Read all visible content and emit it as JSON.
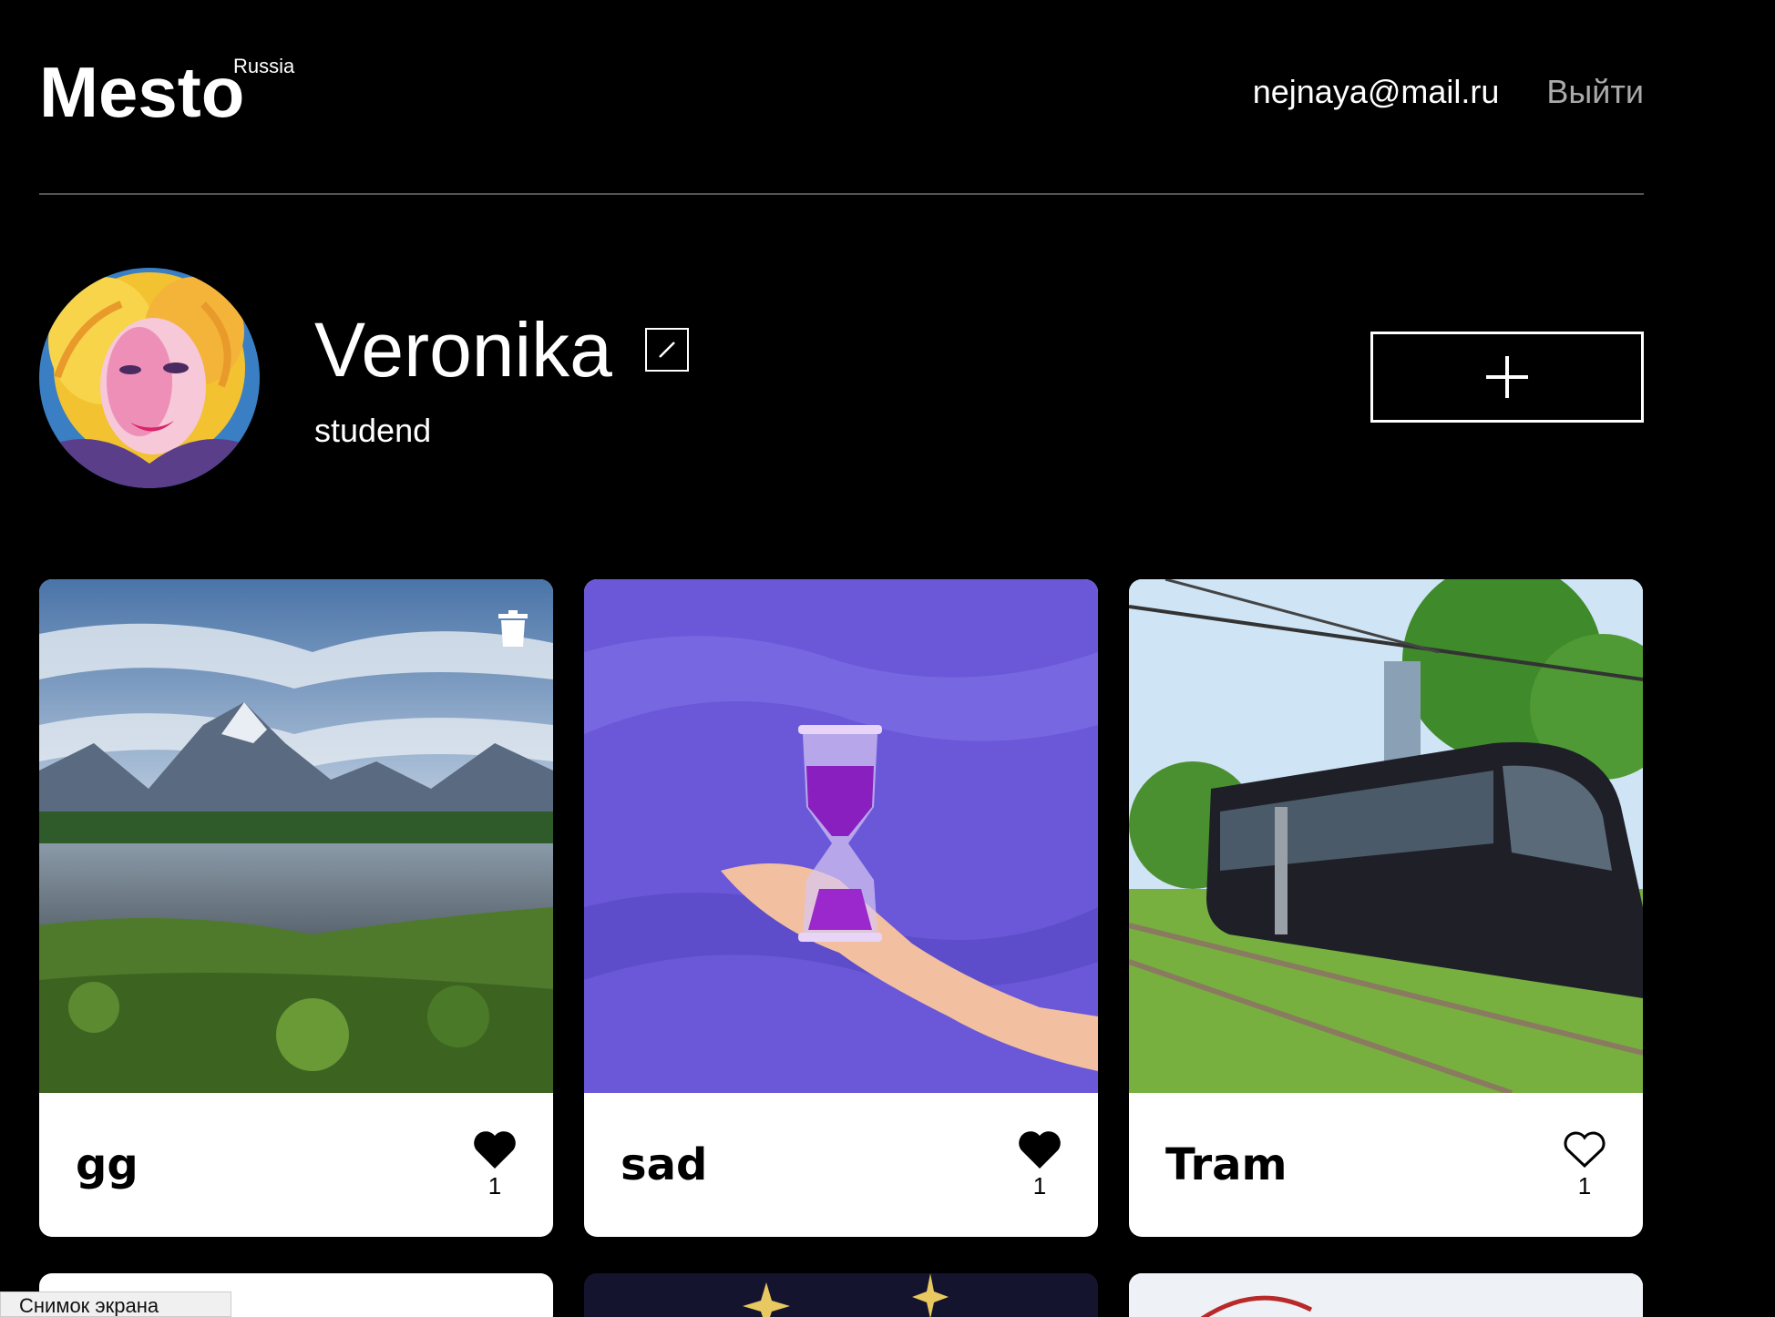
{
  "header": {
    "logo": "Mesto",
    "logo_sup": "Russia",
    "email": "nejnaya@mail.ru",
    "logout": "Выйти"
  },
  "profile": {
    "name": "Veronika",
    "about": "studend"
  },
  "cards": [
    {
      "title": "gg",
      "likes": "1",
      "liked": true,
      "deletable": true
    },
    {
      "title": "sad",
      "likes": "1",
      "liked": true,
      "deletable": false
    },
    {
      "title": "Tram",
      "likes": "1",
      "liked": false,
      "deletable": false
    }
  ],
  "tooltip": "Снимок экрана",
  "icons": {
    "edit": "pencil-icon",
    "add": "plus-icon",
    "trash": "trash-icon",
    "like": "heart-icon"
  }
}
